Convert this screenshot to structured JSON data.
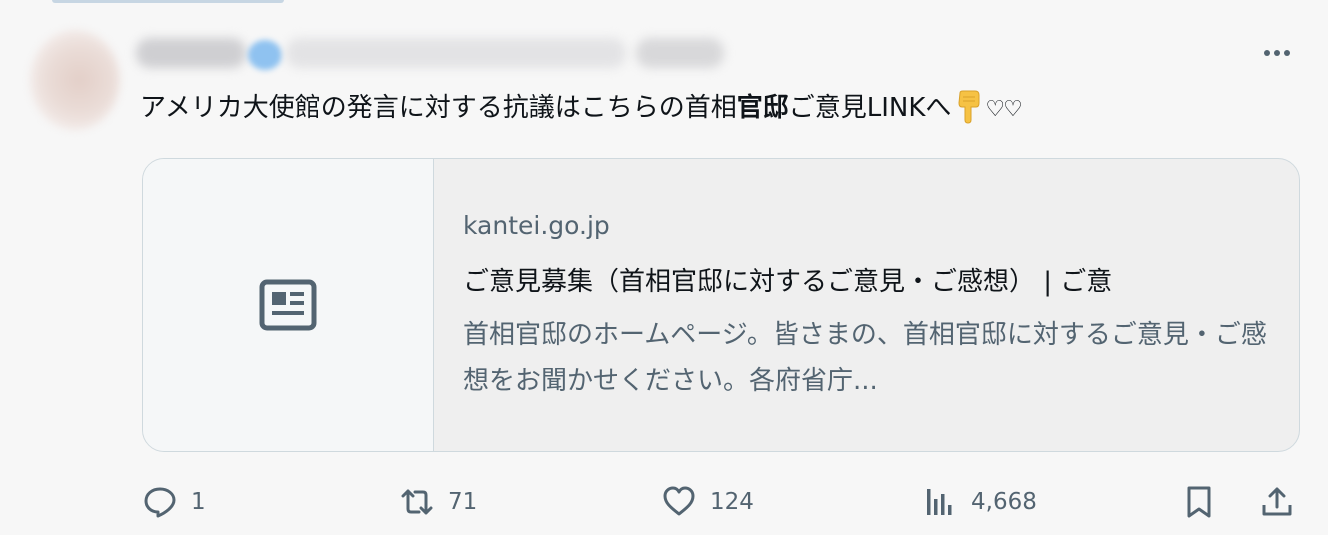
{
  "tweet": {
    "text_prefix": "アメリカ大使館の発言に対する抗議はこちらの首相",
    "text_bold": "官邸",
    "text_suffix": "ご意見LINKへ",
    "hearts": "♡♡",
    "emoji": "backhand-index-pointing-down"
  },
  "card": {
    "domain": "kantei.go.jp",
    "title": "ご意見募集（首相官邸に対するご意見・ご感想） | ご意",
    "description": "首相官邸のホームページ。皆さまの、首相官邸に対するご意見・ご感想をお聞かせください。各府省庁..."
  },
  "actions": {
    "replies": "1",
    "retweets": "71",
    "likes": "124",
    "views": "4,668"
  },
  "icons": [
    "more-icon",
    "article-icon",
    "reply-icon",
    "retweet-icon",
    "like-icon",
    "views-icon",
    "bookmark-icon",
    "share-icon"
  ],
  "colors": {
    "text": "#0f1419",
    "secondary": "#536471",
    "border": "#cfd9de",
    "background": "#f7f7f7"
  }
}
